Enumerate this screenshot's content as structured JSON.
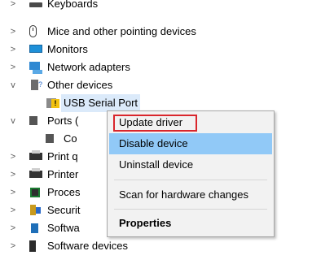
{
  "tree": {
    "keyboards": "Keyboards",
    "mice": "Mice and other pointing devices",
    "monitors": "Monitors",
    "network": "Network adapters",
    "other": "Other devices",
    "usb_serial": "USB Serial Port",
    "ports": "Ports (",
    "ports_child": "Co",
    "print_queues": "Print q",
    "printers": "Printer",
    "processors": "Proces",
    "security": "Securit",
    "software_components": "Softwa",
    "software_devices": "Software devices",
    "expand_glyph": ">",
    "collapse_glyph": "v"
  },
  "context_menu": {
    "update_driver": "Update driver",
    "disable_device": "Disable device",
    "uninstall_device": "Uninstall device",
    "scan": "Scan for hardware changes",
    "properties": "Properties"
  }
}
